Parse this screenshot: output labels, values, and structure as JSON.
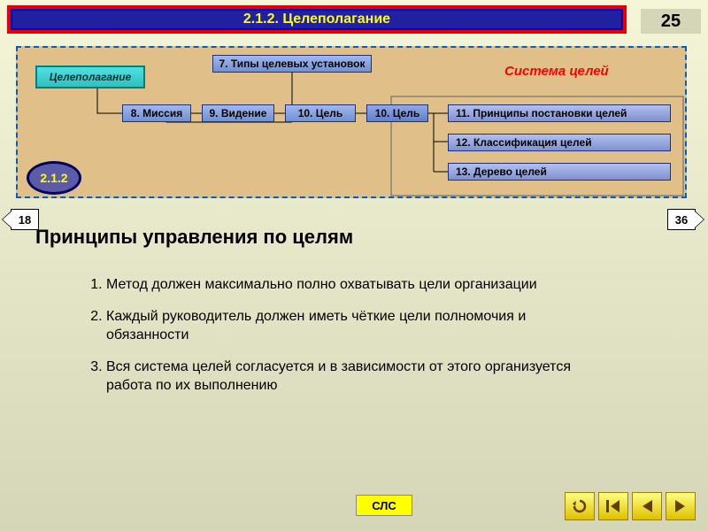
{
  "header": {
    "title": "2.1.2. Целеполагание",
    "page_number": "25"
  },
  "diagram": {
    "main_box": "Целеполагание",
    "top_box": "7. Типы целевых установок",
    "row": {
      "b8": "8. Миссия",
      "b9": "9. Видение",
      "b10": "10. Цель"
    },
    "right": {
      "b11": "11. Принципы постановки целей",
      "b12": "12. Классификация целей",
      "b13": "13. Дерево целей"
    },
    "red_label": "Система целей",
    "badge": "2.1.2"
  },
  "nav": {
    "prev": "18",
    "next": "36"
  },
  "content": {
    "heading": "Принципы управления по целям",
    "items": [
      "Метод должен максимально полно охватывать цели организации",
      "Каждый руководитель должен иметь чёткие цели полномочия и обязанности",
      "Вся система целей согласуется и в зависимости от этого организуется работа по их выполнению"
    ]
  },
  "footer": {
    "sls": "СЛС"
  }
}
